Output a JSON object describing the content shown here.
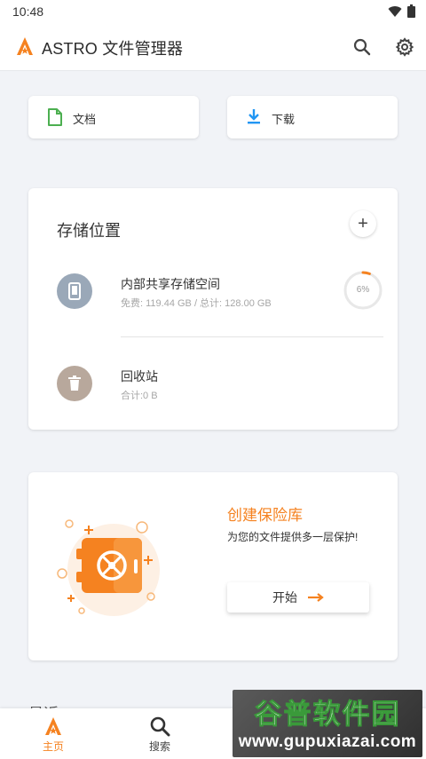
{
  "status_bar": {
    "time": "10:48"
  },
  "app_bar": {
    "title": "ASTRO 文件管理器"
  },
  "quick_access": [
    {
      "label": "文档",
      "icon": "document-icon"
    },
    {
      "label": "下载",
      "icon": "download-icon"
    }
  ],
  "storage": {
    "title": "存储位置",
    "add_label": "+",
    "items": [
      {
        "name": "内部共享存储空间",
        "detail": "免费: 119.44 GB / 总计: 128.00 GB",
        "usage_label": "6%",
        "usage_fraction": 0.06
      },
      {
        "name": "回收站",
        "detail": "合计:0 B"
      }
    ]
  },
  "vault": {
    "title": "创建保险库",
    "description": "为您的文件提供多一层保护!",
    "start_label": "开始"
  },
  "recent": {
    "title": "最近"
  },
  "bottom_nav": [
    {
      "label": "主页",
      "active": true
    },
    {
      "label": "搜索",
      "active": false
    }
  ],
  "watermark": {
    "line1": "谷普软件园",
    "line2": "www.gupuxiazai.com"
  },
  "colors": {
    "accent": "#f58220",
    "doc_green": "#4caf50",
    "download_blue": "#2196f3",
    "storage_grey": "#9aa8b8",
    "trash_brown": "#b8a89c"
  }
}
